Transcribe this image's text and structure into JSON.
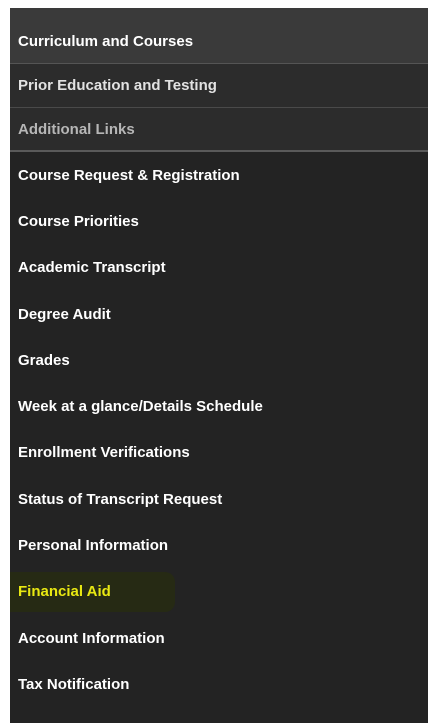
{
  "tabs": [
    {
      "label": "Curriculum and Courses",
      "state": "active"
    },
    {
      "label": "Prior Education and Testing",
      "state": "plain"
    },
    {
      "label": "Additional Links",
      "state": "muted"
    }
  ],
  "links": [
    {
      "label": "Course Request & Registration"
    },
    {
      "label": "Course Priorities"
    },
    {
      "label": "Academic Transcript"
    },
    {
      "label": "Degree Audit"
    },
    {
      "label": "Grades"
    },
    {
      "label": "Week at a glance/Details Schedule"
    },
    {
      "label": "Enrollment Verifications"
    },
    {
      "label": "Status of Transcript Request"
    },
    {
      "label": "Personal Information"
    },
    {
      "label": "Financial Aid",
      "highlighted": true
    },
    {
      "label": "Account Information"
    },
    {
      "label": "Tax Notification"
    }
  ],
  "colors": {
    "panel_bg": "#232323",
    "active_tab_bg": "#3a3a3a",
    "highlight_text": "#e8e812"
  }
}
